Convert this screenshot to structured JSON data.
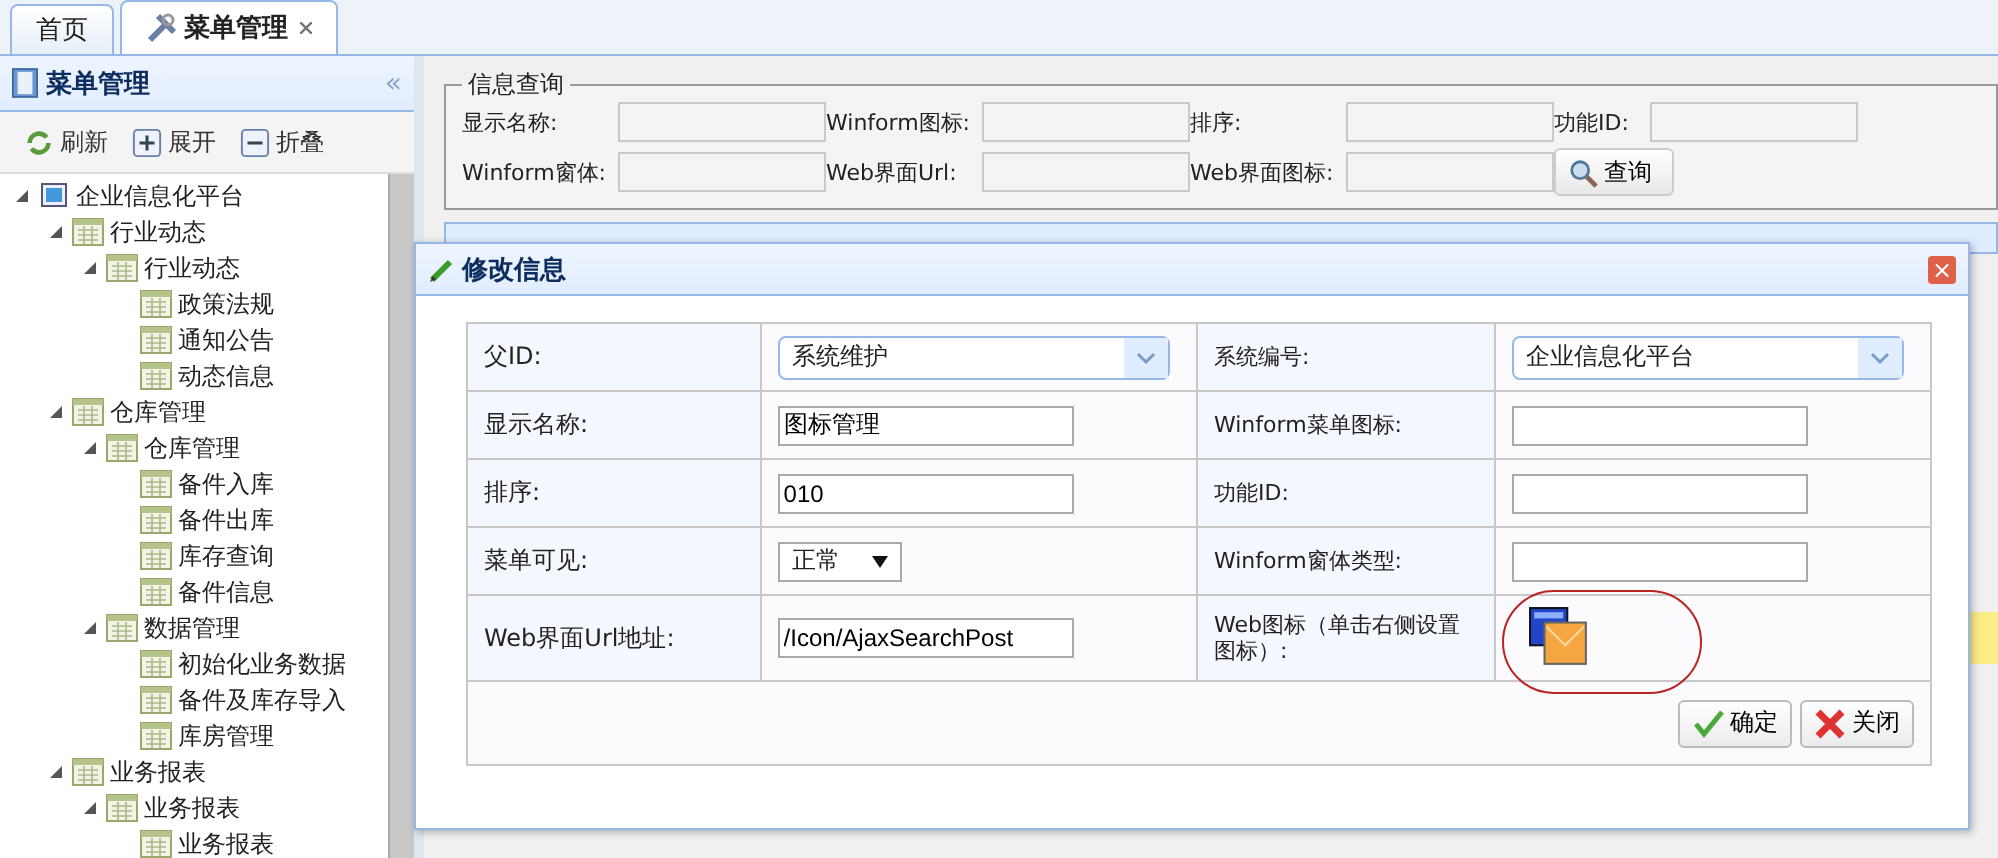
{
  "tabs": [
    {
      "label": "首页",
      "selected": false,
      "closable": false
    },
    {
      "label": "菜单管理",
      "selected": true,
      "closable": true
    }
  ],
  "sidebar": {
    "title": "菜单管理",
    "collapse": "«",
    "toolbar": [
      {
        "kind": "refresh",
        "label": "刷新"
      },
      {
        "kind": "expand",
        "label": "展开"
      },
      {
        "kind": "collapse",
        "label": "折叠"
      }
    ],
    "tree": [
      {
        "label": "企业信息化平台",
        "kind": "root",
        "expanded": true,
        "children": [
          {
            "label": "行业动态",
            "expanded": true,
            "children": [
              {
                "label": "行业动态",
                "expanded": true,
                "children": [
                  {
                    "label": "政策法规"
                  },
                  {
                    "label": "通知公告"
                  },
                  {
                    "label": "动态信息"
                  }
                ]
              }
            ]
          },
          {
            "label": "仓库管理",
            "expanded": true,
            "children": [
              {
                "label": "仓库管理",
                "expanded": true,
                "children": [
                  {
                    "label": "备件入库"
                  },
                  {
                    "label": "备件出库"
                  },
                  {
                    "label": "库存查询"
                  },
                  {
                    "label": "备件信息"
                  }
                ]
              },
              {
                "label": "数据管理",
                "expanded": true,
                "children": [
                  {
                    "label": "初始化业务数据"
                  },
                  {
                    "label": "备件及库存导入"
                  },
                  {
                    "label": "库房管理"
                  }
                ]
              }
            ]
          },
          {
            "label": "业务报表",
            "expanded": true,
            "children": [
              {
                "label": "业务报表",
                "expanded": true,
                "children": [
                  {
                    "label": "业务报表"
                  }
                ]
              }
            ]
          }
        ]
      }
    ]
  },
  "query": {
    "legend": "信息查询",
    "fields": [
      {
        "label": "显示名称:"
      },
      {
        "label": "Winform图标:"
      },
      {
        "label": "排序:"
      },
      {
        "label": "功能ID:"
      },
      {
        "label": "Winform窗体:"
      },
      {
        "label": "Web界面Url:"
      },
      {
        "label": "Web界面图标:"
      }
    ],
    "button": "查询"
  },
  "dialog": {
    "title": "修改信息",
    "close": "×",
    "rows": [
      [
        {
          "label": "父ID:",
          "kind": "combo",
          "value": "系统维护"
        },
        {
          "label": "系统编号:",
          "kind": "combo",
          "value": "企业信息化平台"
        }
      ],
      [
        {
          "label": "显示名称:",
          "kind": "text",
          "value": "图标管理"
        },
        {
          "label": "Winform菜单图标:",
          "kind": "text"
        }
      ],
      [
        {
          "label": "排序:",
          "kind": "text",
          "value": "010"
        },
        {
          "label": "功能ID:",
          "kind": "text"
        }
      ],
      [
        {
          "label": "菜单可见:",
          "kind": "select",
          "value": "正常"
        },
        {
          "label": "Winform窗体类型:",
          "kind": "text"
        }
      ],
      [
        {
          "label": "Web界面Url地址:",
          "kind": "text",
          "value": "/Icon/AjaxSearchPost"
        },
        {
          "label": "Web图标（单击右侧设置图标）:",
          "kind": "icon"
        }
      ]
    ],
    "buttons": [
      {
        "kind": "ok",
        "label": "确定"
      },
      {
        "kind": "cancel",
        "label": "关闭"
      }
    ]
  }
}
